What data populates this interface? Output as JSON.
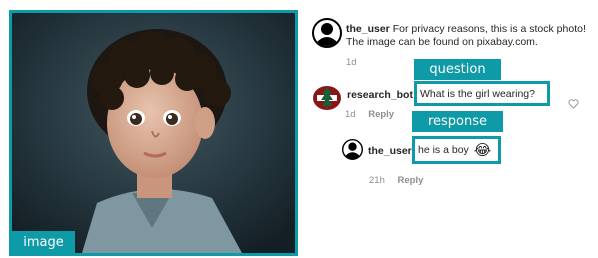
{
  "image_panel": {
    "label": "image",
    "photo_icon": "child-portrait-photo"
  },
  "post": {
    "username": "the_user",
    "caption": "For privacy reasons, this is a stock photo!",
    "caption_line2": "The image can be found on pixabay.com.",
    "time": "1d",
    "avatar_icon": "user-silhouette-icon"
  },
  "question_comment": {
    "tag_label": "question",
    "username": "research_bot",
    "text": "What is the girl wearing?",
    "time": "1d",
    "reply_label": "Reply",
    "avatar_icon": "stanford-tree-logo-icon",
    "like_icon": "heart-outline-icon"
  },
  "response_comment": {
    "tag_label": "response",
    "username": "the_user",
    "text": "he is a boy",
    "emoji": "😂",
    "time": "21h",
    "reply_label": "Reply",
    "avatar_icon": "user-silhouette-icon"
  },
  "colors": {
    "accent_teal": "#0e9aa7",
    "meta_gray": "#8e8e8e",
    "stanford_red": "#8c1515"
  }
}
